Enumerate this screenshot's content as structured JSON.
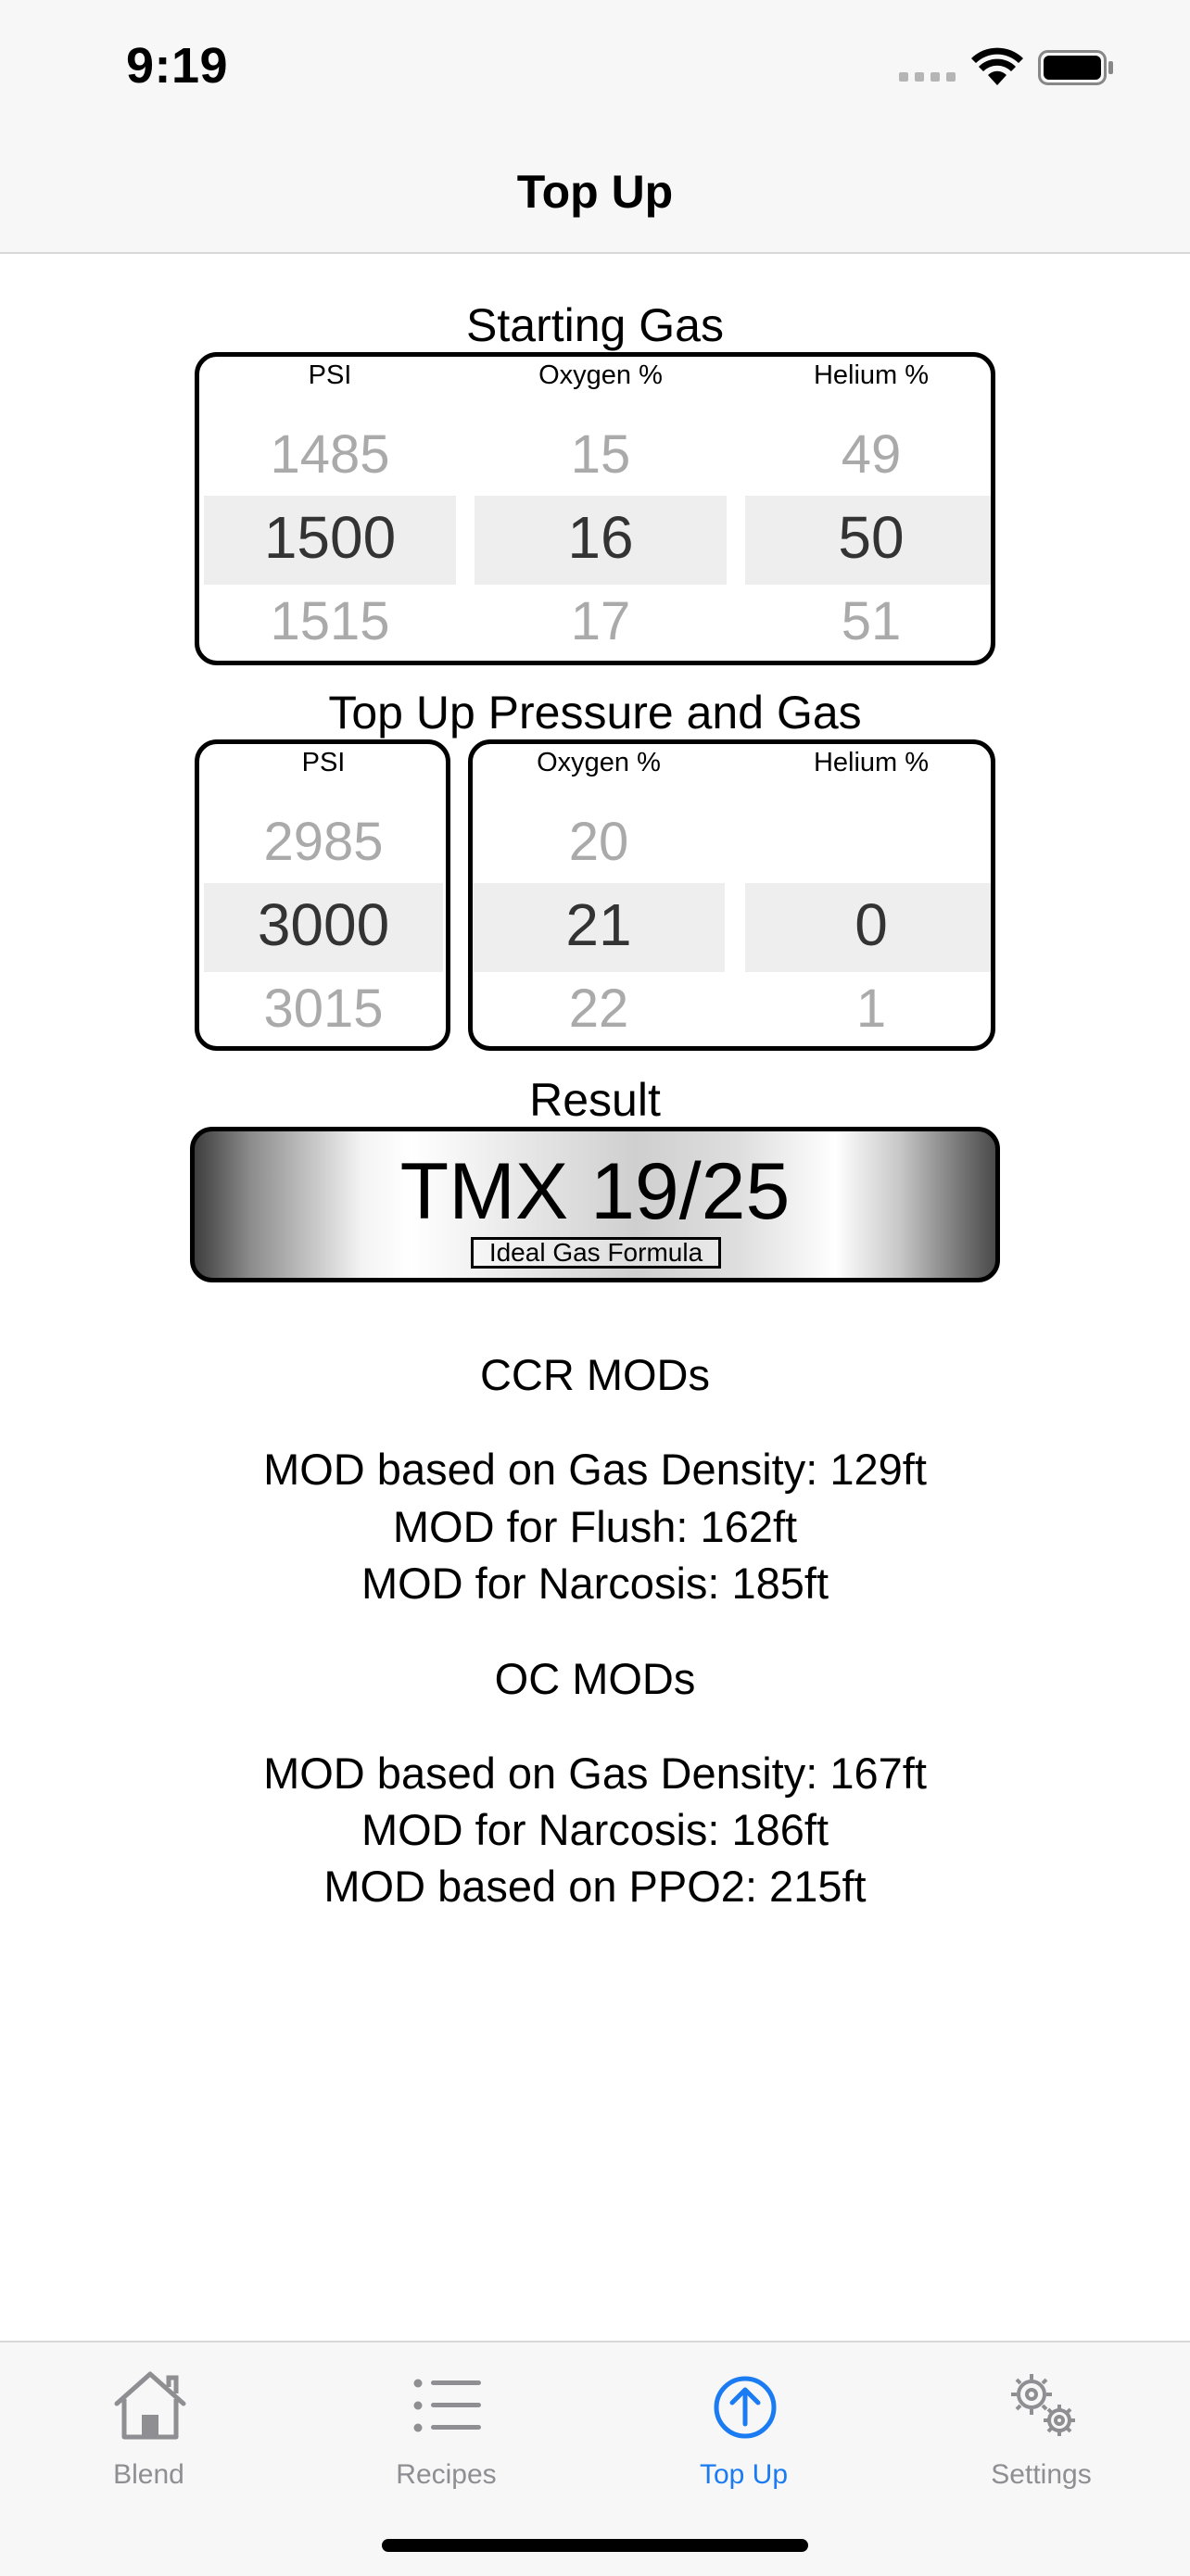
{
  "status_bar": {
    "time": "9:19"
  },
  "nav": {
    "title": "Top Up"
  },
  "starting_gas": {
    "title": "Starting Gas",
    "columns": [
      {
        "label": "PSI",
        "values": [
          "1485",
          "1500",
          "1515"
        ]
      },
      {
        "label": "Oxygen %",
        "values": [
          "15",
          "16",
          "17"
        ]
      },
      {
        "label": "Helium %",
        "values": [
          "49",
          "50",
          "51"
        ]
      }
    ]
  },
  "top_up": {
    "title": "Top Up Pressure and Gas",
    "pressure": {
      "label": "PSI",
      "values": [
        "2985",
        "3000",
        "3015"
      ]
    },
    "oxygen": {
      "label": "Oxygen %",
      "values": [
        "20",
        "21",
        "22"
      ]
    },
    "helium": {
      "label": "Helium %",
      "values": [
        "",
        "0",
        "1"
      ]
    }
  },
  "result": {
    "title": "Result",
    "mix": "TMX 19/25",
    "formula": "Ideal Gas Formula"
  },
  "ccr": {
    "title": "CCR MODs",
    "lines": [
      "MOD based on Gas Density: 129ft",
      "MOD for Flush: 162ft",
      "MOD for Narcosis: 185ft"
    ]
  },
  "oc": {
    "title": "OC MODs",
    "lines": [
      "MOD based on Gas Density: 167ft",
      "MOD for Narcosis: 186ft",
      "MOD based on PPO2: 215ft"
    ]
  },
  "tabs": [
    {
      "label": "Blend",
      "icon": "house-icon"
    },
    {
      "label": "Recipes",
      "icon": "list-icon"
    },
    {
      "label": "Top Up",
      "icon": "arrow-up-circle-icon"
    },
    {
      "label": "Settings",
      "icon": "gears-icon"
    }
  ],
  "colors": {
    "accent": "#1a7bf2",
    "inactive": "#8e8e93"
  }
}
